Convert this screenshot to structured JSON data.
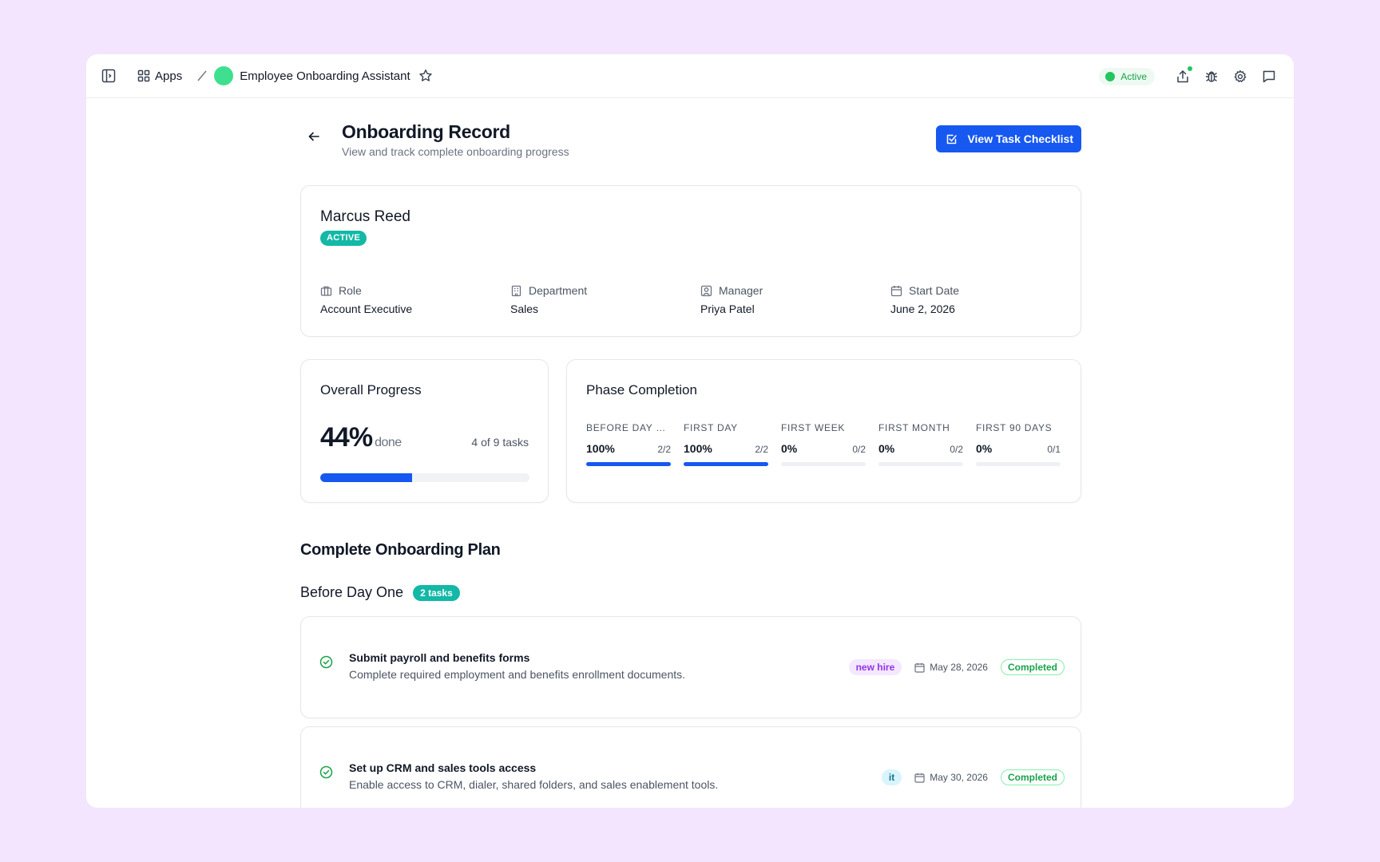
{
  "topbar": {
    "apps_label": "Apps",
    "app_name": "Employee Onboarding Assistant",
    "status_label": "Active",
    "colors": {
      "status": "#22c55e",
      "app_dot": "#3ee08f"
    }
  },
  "page": {
    "title": "Onboarding Record",
    "subtitle": "View and track complete onboarding progress",
    "checklist_button": "View Task Checklist",
    "accent": "#1658f0"
  },
  "profile": {
    "name": "Marcus Reed",
    "status_badge": "ACTIVE",
    "fields": [
      {
        "icon": "briefcase-icon",
        "label": "Role",
        "value": "Account Executive"
      },
      {
        "icon": "building-icon",
        "label": "Department",
        "value": "Sales"
      },
      {
        "icon": "user-badge-icon",
        "label": "Manager",
        "value": "Priya Patel"
      },
      {
        "icon": "calendar-icon",
        "label": "Start Date",
        "value": "June 2, 2026"
      }
    ]
  },
  "progress": {
    "title": "Overall Progress",
    "percent": "44%",
    "percent_value": 44,
    "suffix": "done",
    "tasks_label": "4 of 9 tasks"
  },
  "phases": {
    "title": "Phase Completion",
    "items": [
      {
        "name": "BEFORE DAY O...",
        "percent": "100%",
        "fraction": "2/2",
        "fill": 100
      },
      {
        "name": "FIRST DAY",
        "percent": "100%",
        "fraction": "2/2",
        "fill": 100
      },
      {
        "name": "FIRST WEEK",
        "percent": "0%",
        "fraction": "0/2",
        "fill": 0
      },
      {
        "name": "FIRST MONTH",
        "percent": "0%",
        "fraction": "0/2",
        "fill": 0
      },
      {
        "name": "FIRST 90 DAYS",
        "percent": "0%",
        "fraction": "0/1",
        "fill": 0
      }
    ]
  },
  "plan": {
    "title": "Complete Onboarding Plan",
    "group_name": "Before Day One",
    "group_count": "2 tasks",
    "tasks": [
      {
        "title": "Submit payroll and benefits forms",
        "description": "Complete required employment and benefits enrollment documents.",
        "tag": "new hire",
        "tag_color": "purple",
        "due": "May 28, 2026",
        "status": "Completed"
      },
      {
        "title": "Set up CRM and sales tools access",
        "description": "Enable access to CRM, dialer, shared folders, and sales enablement tools.",
        "tag": "it",
        "tag_color": "cyan",
        "due": "May 30, 2026",
        "status": "Completed"
      }
    ]
  }
}
